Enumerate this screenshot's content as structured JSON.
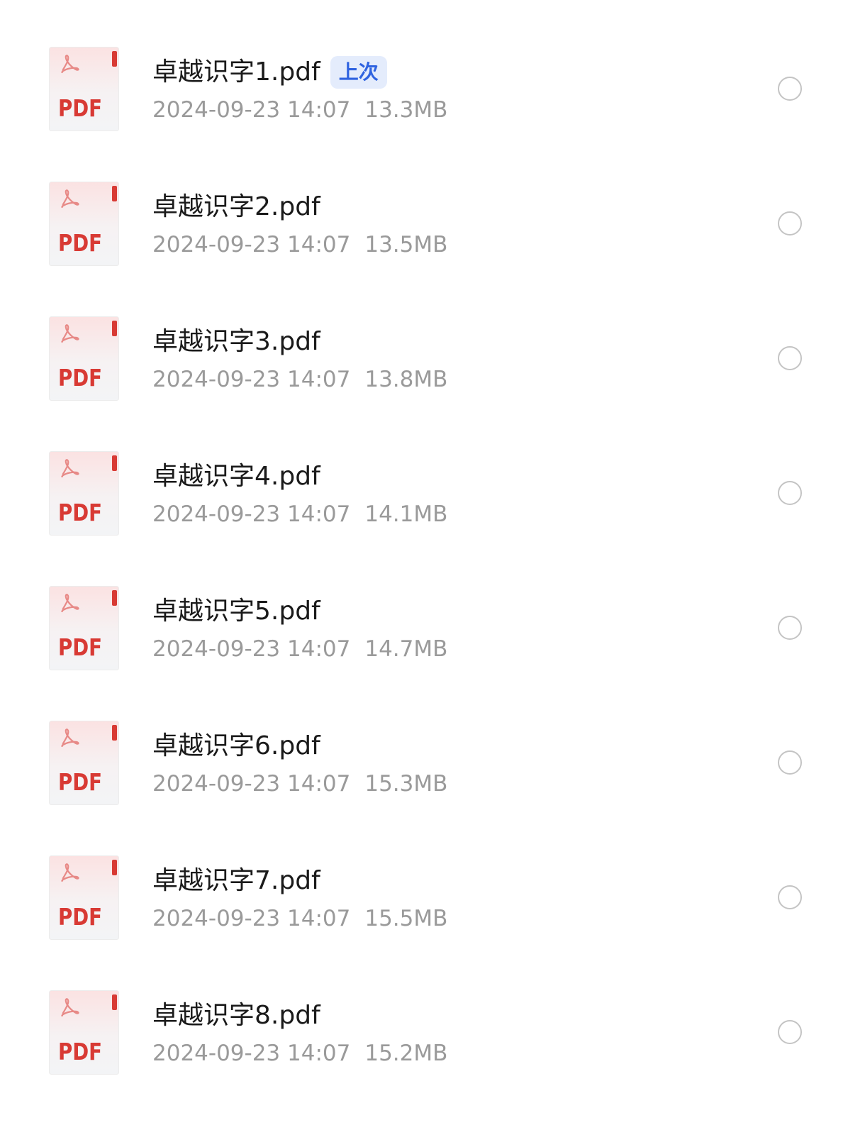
{
  "icons": {
    "file_type_text": "PDF",
    "file_icon": "pdf-file-icon",
    "select_icon": "radio-circle-icon"
  },
  "colors": {
    "pdf_red": "#d83a34",
    "badge_background": "#e4ecfc",
    "badge_text": "#2f63e0",
    "meta_text": "#9a9a9a"
  },
  "files": [
    {
      "name": "卓越识字1.pdf",
      "badge": "上次",
      "date": "2024-09-23 14:07",
      "size": "13.3MB"
    },
    {
      "name": "卓越识字2.pdf",
      "badge": "",
      "date": "2024-09-23 14:07",
      "size": "13.5MB"
    },
    {
      "name": "卓越识字3.pdf",
      "badge": "",
      "date": "2024-09-23 14:07",
      "size": "13.8MB"
    },
    {
      "name": "卓越识字4.pdf",
      "badge": "",
      "date": "2024-09-23 14:07",
      "size": "14.1MB"
    },
    {
      "name": "卓越识字5.pdf",
      "badge": "",
      "date": "2024-09-23 14:07",
      "size": "14.7MB"
    },
    {
      "name": "卓越识字6.pdf",
      "badge": "",
      "date": "2024-09-23 14:07",
      "size": "15.3MB"
    },
    {
      "name": "卓越识字7.pdf",
      "badge": "",
      "date": "2024-09-23 14:07",
      "size": "15.5MB"
    },
    {
      "name": "卓越识字8.pdf",
      "badge": "",
      "date": "2024-09-23 14:07",
      "size": "15.2MB"
    }
  ]
}
